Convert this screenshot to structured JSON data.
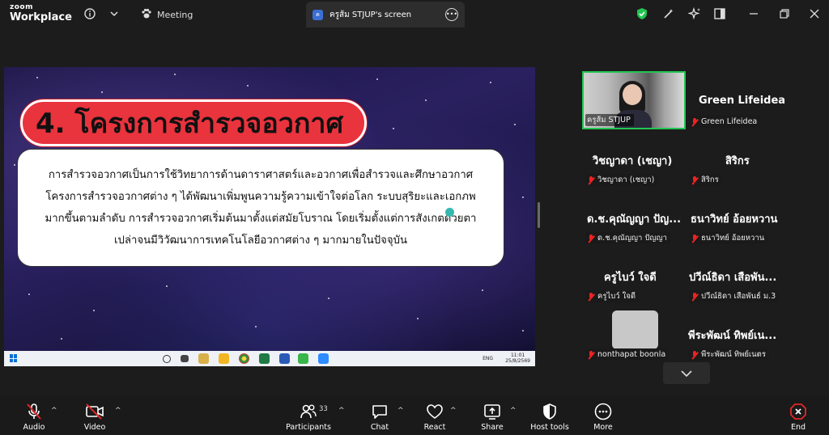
{
  "app": {
    "brand_line1": "zoom",
    "brand_line2": "Workplace"
  },
  "titlebar": {
    "meeting_label": "Meeting",
    "share_tab_label": "ครูส้ม STJUP's screen",
    "share_avatar_letter": "ค",
    "colors": {
      "shield": "#23c552"
    }
  },
  "slide": {
    "title": "4. โครงการสำรวจอวกาศ",
    "body_lines": [
      "การสำรวจอวกาศเป็นการใช้วิทยาการด้านดาราศาสตร์และอวกาศเพื่อสำรวจและศึกษาอวกาศ",
      "โครงการสำรวจอวกาศต่าง ๆ ได้พัฒนาเพิ่มพูนความรู้ความเข้าใจต่อโลก ระบบสุริยะและเอกภพ",
      "มากขึ้นตามลำดับ การสำรวจอวกาศเริ่มต้นมาตั้งแต่สมัยโบราณ โดยเริ่มตั้งแต่การสังเกตด้วยตา",
      "เปล่าจนมีวิวัฒนาการเทคโนโลยีอวกาศต่าง ๆ มากมายในปัจจุบัน"
    ]
  },
  "shared_taskbar": {
    "lang": "ENG",
    "time": "11:01",
    "date": "25/8/2569"
  },
  "gallery": {
    "video_label": "ครูส้ม STJUP",
    "participants": [
      {
        "name": "Green Lifeidea",
        "label": "Green Lifeidea"
      },
      {
        "name": "วิชญาดา (เชญา)",
        "label": "วิชญาดา (เชญา)"
      },
      {
        "name": "สิริกร",
        "label": "สิริกร"
      },
      {
        "name": "ด.ช.คุณัญญา ปัญ...",
        "label": "ด.ช.คุณัญญา ปัญญา"
      },
      {
        "name": "ธนาวิทย์ อ้อยหวาน",
        "label": "ธนาวิทย์ อ้อยหวาน"
      },
      {
        "name": "ครูไบว์ ใจดี",
        "label": "ครูไบว์ ใจดี"
      },
      {
        "name": "ปวีณ์ธิดา เสือพัน...",
        "label": "ปวีณ์ธิดา เสือพันธ์ ม.3"
      },
      {
        "name": "",
        "label": "nonthapat boonla"
      },
      {
        "name": "พีระพัฒน์ ทิพย์เน...",
        "label": "พีระพัฒน์ ทิพย์เนตร"
      }
    ]
  },
  "toolbar": {
    "audio": "Audio",
    "video": "Video",
    "participants": "Participants",
    "participants_count": "33",
    "chat": "Chat",
    "react": "React",
    "share": "Share",
    "host_tools": "Host tools",
    "more": "More",
    "end": "End",
    "colors": {
      "end": "#e02828",
      "muted": "#e02828"
    }
  }
}
